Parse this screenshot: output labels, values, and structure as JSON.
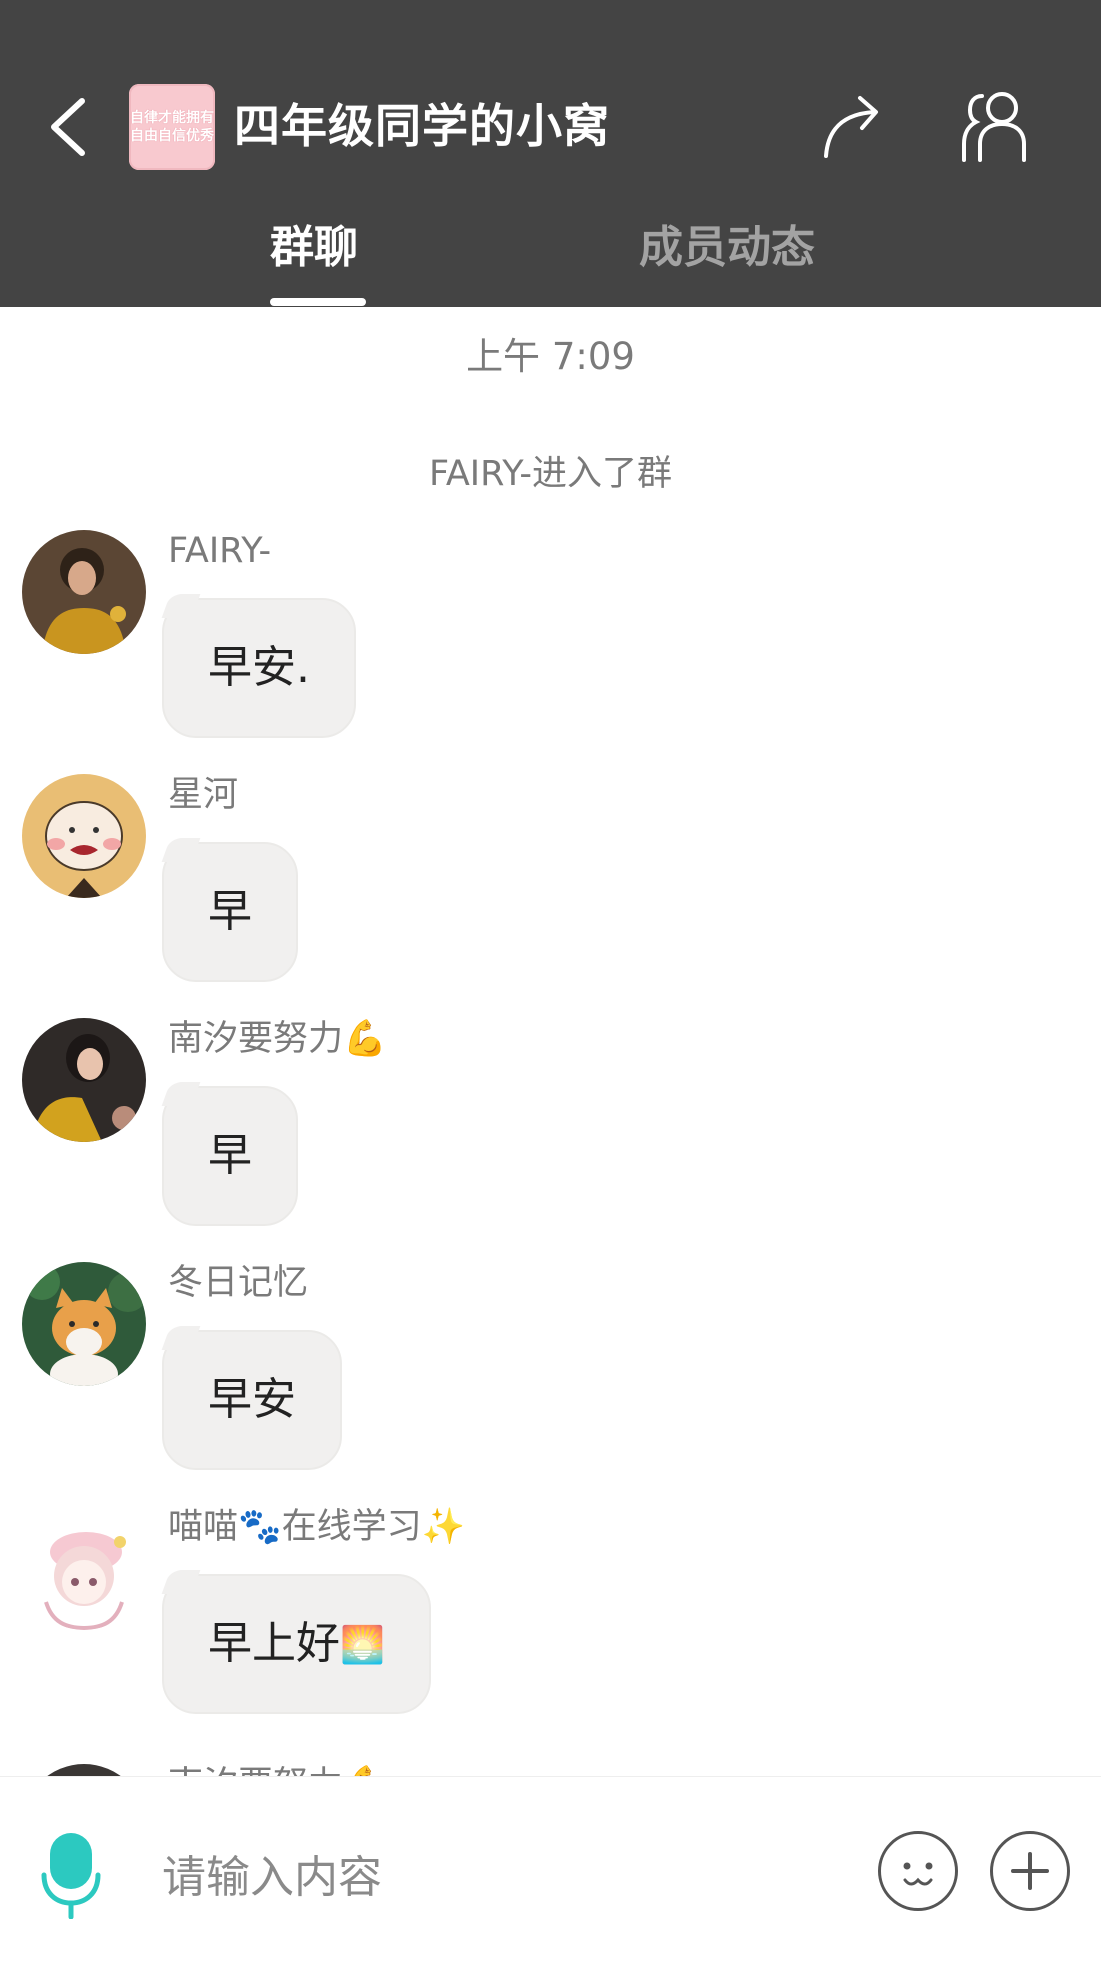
{
  "header": {
    "title": "四年级同学的小窝",
    "group_icon_text": [
      "自律才能拥有",
      "自由自信优秀"
    ],
    "tabs": [
      {
        "label": "群聊",
        "active": true
      },
      {
        "label": "成员动态",
        "active": false
      }
    ],
    "icons": {
      "back": "back-arrow-icon",
      "share": "share-icon",
      "members": "group-members-icon"
    }
  },
  "chat": {
    "timestamp": "上午 7:09",
    "system_message": "FAIRY-进入了群",
    "messages": [
      {
        "sender": "FAIRY-",
        "text": "早安.",
        "avatar": "photo-girl-avatar"
      },
      {
        "sender": "星河",
        "text": "早",
        "avatar": "cartoon-boy-avatar"
      },
      {
        "sender": "南汐要努力",
        "sender_emoji": "💪",
        "text": "早",
        "avatar": "photo-girl-selfie-avatar"
      },
      {
        "sender": "冬日记忆",
        "text": "早安",
        "avatar": "orange-cat-avatar"
      },
      {
        "sender": "喵喵",
        "sender_emoji": "🐾",
        "sender_suffix": "在线学习",
        "sender_suffix_emoji": "✨",
        "text": "早上好",
        "text_emoji": "🌅",
        "avatar": "anime-girl-avatar"
      },
      {
        "sender": "南汐要努力",
        "sender_emoji": "💪",
        "text": "",
        "avatar": "photo-girl-selfie-avatar"
      }
    ]
  },
  "input": {
    "placeholder": "请输入内容",
    "icons": {
      "mic": "microphone-icon",
      "emoji": "emoji-face-icon",
      "plus": "plus-icon"
    }
  },
  "colors": {
    "header_bg": "#444444",
    "tab_active": "#ffffff",
    "tab_inactive": "#a3a3a3",
    "bubble_bg": "#f1f0ef",
    "meta_text": "#7a7a7a",
    "mic_accent": "#2cc9c0"
  }
}
